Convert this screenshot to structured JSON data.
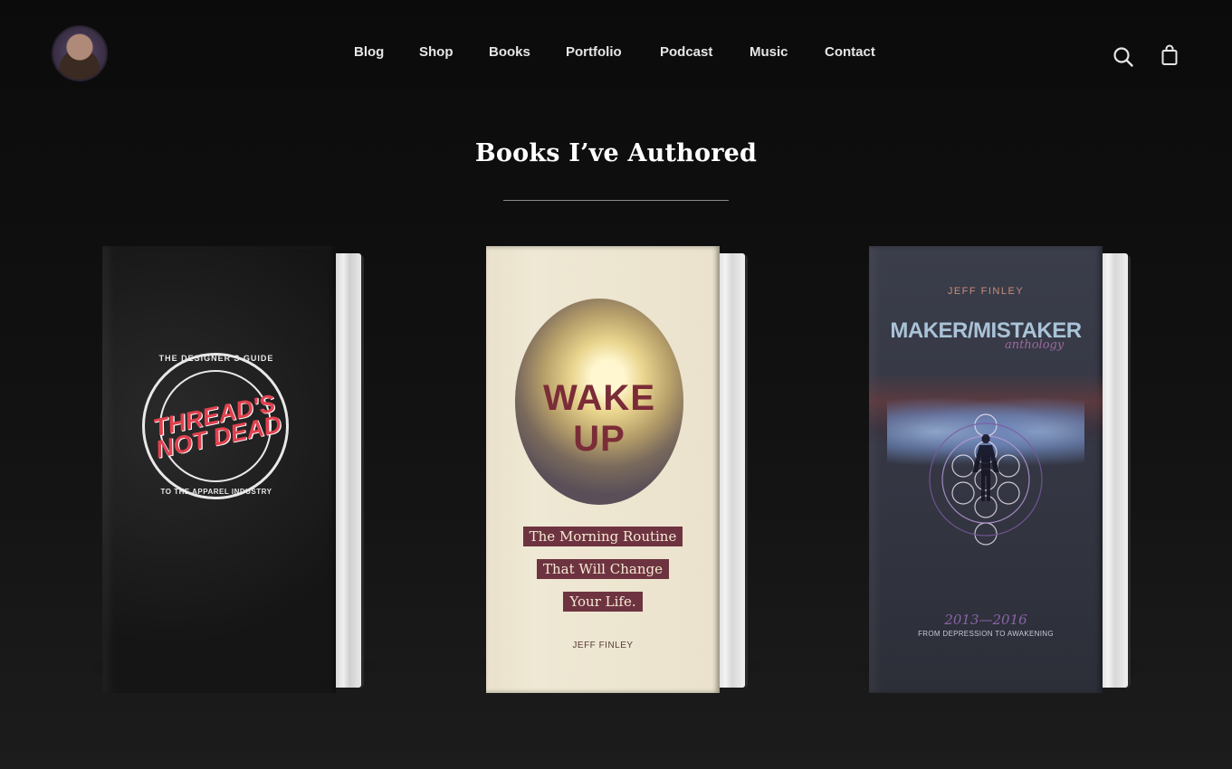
{
  "header": {
    "nav": [
      {
        "label": "Blog"
      },
      {
        "label": "Shop"
      },
      {
        "label": "Books"
      },
      {
        "label": "Portfolio"
      },
      {
        "label": "Podcast"
      },
      {
        "label": "Music"
      },
      {
        "label": "Contact"
      }
    ],
    "icons": {
      "search": "search-icon",
      "cart": "shopping-bag-icon",
      "avatar": "profile-avatar"
    }
  },
  "main": {
    "heading": "Books I’ve Authored",
    "books": [
      {
        "top_text": "THE DESIGNER'S GUIDE",
        "title": "THREAD'S NOT DEAD",
        "bottom_text": "TO THE APPAREL INDUSTRY"
      },
      {
        "title": "WAKE UP",
        "tagline": [
          "The Morning Routine",
          "That Will Change",
          "Your Life."
        ],
        "author": "JEFF FINLEY"
      },
      {
        "author": "JEFF FINLEY",
        "title": "MAKER/MISTAKER",
        "subtitle": "anthology",
        "years": "2013—2016",
        "tagline": "FROM DEPRESSION TO AWAKENING"
      }
    ]
  },
  "colors": {
    "background": "#111111",
    "nav_text": "#e6e6e6",
    "wake_up_accent": "#6e3340",
    "threads_red": "#e0414e"
  }
}
